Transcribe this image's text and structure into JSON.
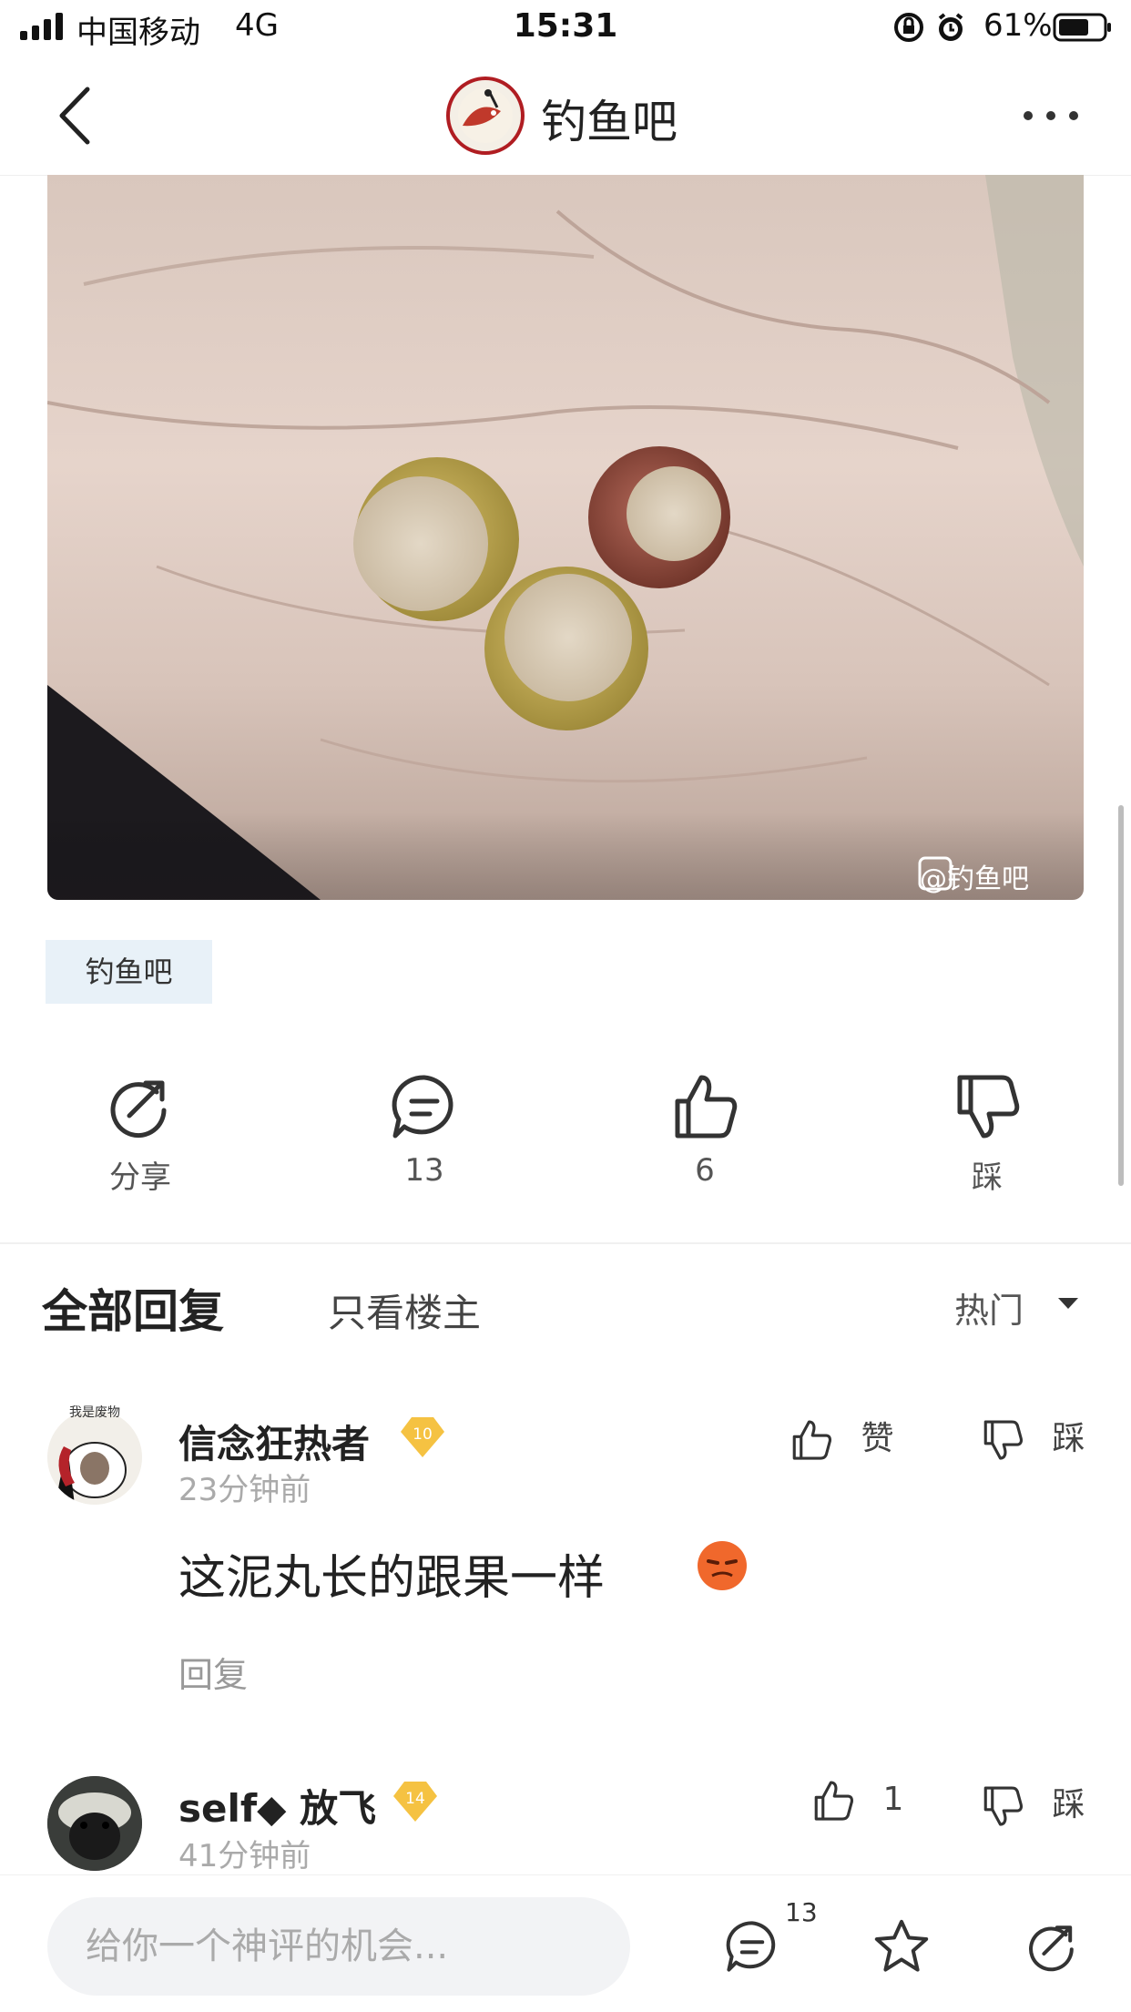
{
  "status_bar": {
    "carrier": "中国移动",
    "network": "4G",
    "time": "15:31",
    "battery": "61%"
  },
  "nav": {
    "forum_title": "钓鱼吧",
    "back_icon": "chevron-left-icon",
    "more_icon": "more-dots-icon"
  },
  "post": {
    "image_watermark": "@钓鱼吧",
    "forum_tag": "钓鱼吧"
  },
  "actions": {
    "share_label": "分享",
    "comment_count": "13",
    "like_count": "6",
    "dislike_label": "踩"
  },
  "replies_header": {
    "all_tab": "全部回复",
    "op_only_tab": "只看楼主",
    "sort_label": "热门"
  },
  "comments": [
    {
      "username": "信念狂热者",
      "level": "10",
      "time": "23分钟前",
      "text": "这泥丸长的跟果一样",
      "like_label": "赞",
      "dislike_label": "踩",
      "reply_label": "回复",
      "avatar_text": "我是废物"
    },
    {
      "username": "self◆ 放飞",
      "level": "14",
      "time": "41分钟前",
      "like_count": "1",
      "dislike_label": "踩"
    }
  ],
  "bottom_bar": {
    "input_placeholder": "给你一个神评的机会...",
    "comment_count": "13"
  },
  "colors": {
    "accent_blue": "#e8f1f8",
    "level_badge": "#f5c242",
    "brand_red": "#b01d22"
  }
}
